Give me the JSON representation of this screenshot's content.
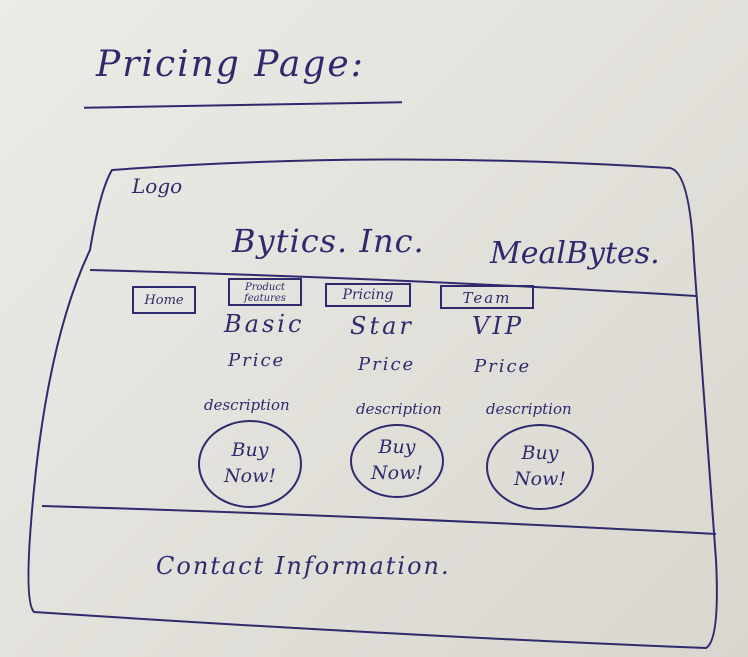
{
  "sketch": {
    "title": "Pricing Page:",
    "logo": "Logo",
    "company_name": "Bytics. Inc.",
    "product_name": "MealBytes.",
    "nav": {
      "home": "Home",
      "product_features": "Product features",
      "pricing": "Pricing",
      "team": "Team"
    },
    "plans": [
      {
        "name": "Basic",
        "price": "Price",
        "description": "description",
        "button": "Buy\nNow!"
      },
      {
        "name": "Star",
        "price": "Price",
        "description": "description",
        "button": "Buy\nNow!"
      },
      {
        "name": "VIP",
        "price": "Price",
        "description": "description",
        "button": "Buy\nNow!"
      }
    ],
    "footer": "Contact Information."
  },
  "colors": {
    "ink": "#2f2a6e",
    "paper": "#e4e2dc"
  }
}
